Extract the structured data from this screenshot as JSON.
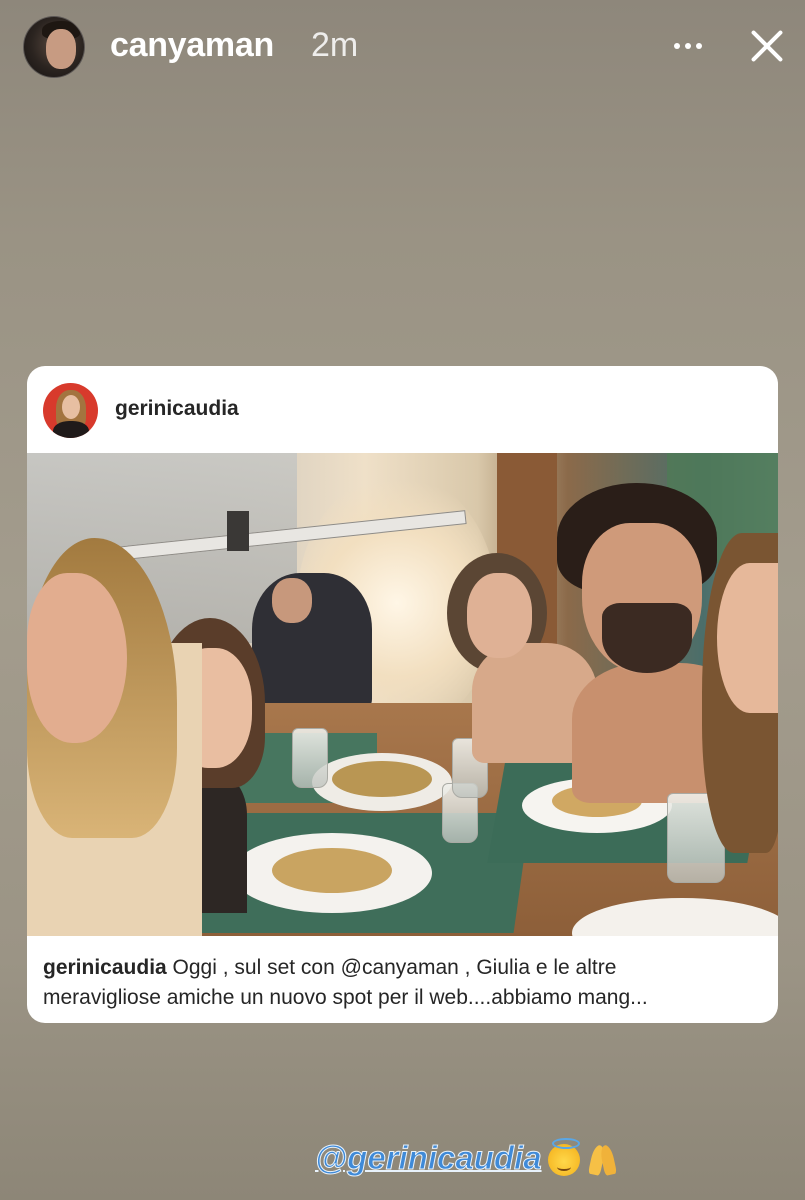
{
  "story": {
    "username": "canyaman",
    "time_ago": "2m",
    "avatar_icon": "profile-avatar",
    "more_icon": "more-dots-icon",
    "close_icon": "close-icon"
  },
  "post": {
    "username": "gerinicaudia",
    "avatar_icon": "profile-avatar",
    "photo_description_icon": "photo",
    "caption": {
      "username": "gerinicaudia",
      "line1": " Oggi , sul set con @canyaman , Giulia e le altre",
      "line2": "meravigliose amiche un nuovo spot per il web....abbiamo mang..."
    }
  },
  "sticker": {
    "mention": "@gerinicaudia",
    "emoji_1": "smiling-face-with-halo",
    "emoji_2": "folded-hands"
  },
  "colors": {
    "mention_blue": "#3f8ad8",
    "text_dark": "#262626",
    "card_bg": "#ffffff",
    "story_bg": "#9a9384"
  }
}
